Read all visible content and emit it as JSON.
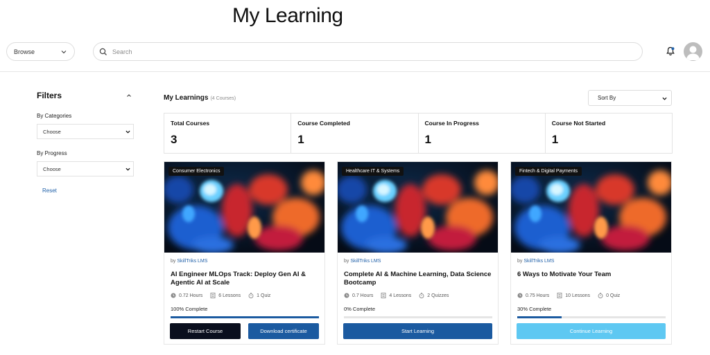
{
  "page": {
    "title": "My Learning"
  },
  "topbar": {
    "browse_label": "Browse",
    "search_placeholder": "Search",
    "icons": {
      "search": "search-icon",
      "bell": "bell-icon",
      "avatar": "user-avatar"
    },
    "bell_color": "#1e5fa8"
  },
  "filters": {
    "title": "Filters",
    "categories_label": "By Categories",
    "categories_value": "Choose",
    "progress_label": "By Progress",
    "progress_value": "Choose",
    "reset_label": "Reset"
  },
  "main": {
    "title": "My Learnings",
    "count": "(4 Courses)",
    "sort_label": "Sort By"
  },
  "stats": [
    {
      "label": "Total Courses",
      "value": "3"
    },
    {
      "label": "Course Completed",
      "value": "1"
    },
    {
      "label": "Course In Progress",
      "value": "1"
    },
    {
      "label": "Course Not Started",
      "value": "1"
    }
  ],
  "courses": [
    {
      "category": "Consumer Electronics",
      "by": "by",
      "author": "SkillTriks LMS",
      "title": "AI Engineer MLOps Track: Deploy Gen AI & Agentic AI at Scale",
      "hours": "0.72 Hours",
      "lessons": "6 Lessons",
      "quizzes": "1 Quiz",
      "progress_text": "100% Complete",
      "progress": 1.0,
      "buttons": [
        {
          "label": "Restart Course",
          "color": "#0a0f1e"
        },
        {
          "label": "Download certificate",
          "color": "#1b5aa0"
        }
      ]
    },
    {
      "category": "Healthcare IT & Systems",
      "by": "by",
      "author": "SkillTriks LMS",
      "title": "Complete AI & Machine Learning, Data Science Bootcamp",
      "hours": "0.7 Hours",
      "lessons": "4 Lessons",
      "quizzes": "2 Quizzes",
      "progress_text": "0% Complete",
      "progress": 0.0,
      "buttons": [
        {
          "label": "Start Learning",
          "color": "#1b5aa0"
        }
      ]
    },
    {
      "category": "Fintech & Digital Payments",
      "by": "by",
      "author": "SkillTriks LMS",
      "title": "6 Ways to Motivate Your Team",
      "hours": "0.75 Hours",
      "lessons": "10 Lessons",
      "quizzes": "0 Quiz",
      "progress_text": "30% Complete",
      "progress": 0.3,
      "buttons": [
        {
          "label": "Continue Learning",
          "color": "#5ec8f2"
        }
      ]
    }
  ]
}
